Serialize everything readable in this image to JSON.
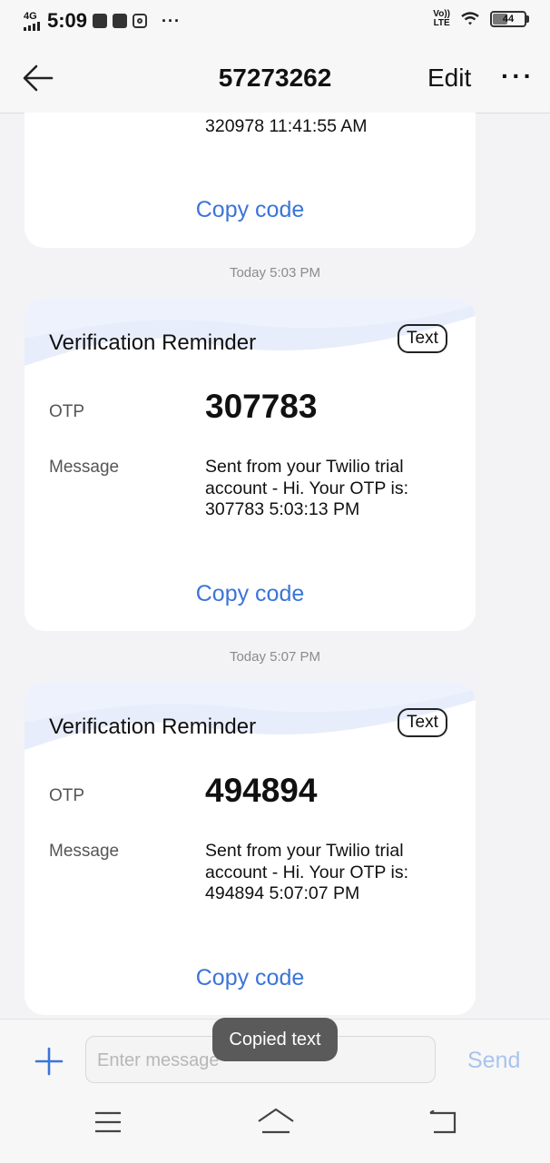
{
  "status_bar": {
    "network": "4G",
    "time": "5:09",
    "volte_line1": "Vo))",
    "volte_line2": "LTE",
    "battery": "44"
  },
  "header": {
    "title": "57273262",
    "edit_label": "Edit"
  },
  "cards": [
    {
      "message_tail": "320978 11:41:55 AM",
      "copy_label": "Copy code"
    },
    {
      "timestamp": "Today 5:03 PM",
      "title": "Verification Reminder",
      "tag": "Text",
      "otp_label": "OTP",
      "otp": "307783",
      "message_label": "Message",
      "message": "Sent from your Twilio trial account - Hi. Your OTP is: 307783 5:03:13 PM",
      "copy_label": "Copy code"
    },
    {
      "timestamp": "Today 5:07 PM",
      "title": "Verification Reminder",
      "tag": "Text",
      "otp_label": "OTP",
      "otp": "494894",
      "message_label": "Message",
      "message": "Sent from your Twilio trial account - Hi. Your OTP is: 494894 5:07:07 PM",
      "copy_label": "Copy code"
    }
  ],
  "composer": {
    "placeholder": "Enter message",
    "send_label": "Send"
  },
  "toast": "Copied text",
  "colors": {
    "accent": "#3a74d9",
    "send_disabled": "#a9c3ee",
    "toast_bg": "#5a5a5a"
  },
  "icons": [
    "back-arrow-icon",
    "more-icon",
    "plus-icon",
    "menu-icon",
    "home-icon",
    "back-nav-icon",
    "wifi-icon",
    "battery-icon"
  ]
}
